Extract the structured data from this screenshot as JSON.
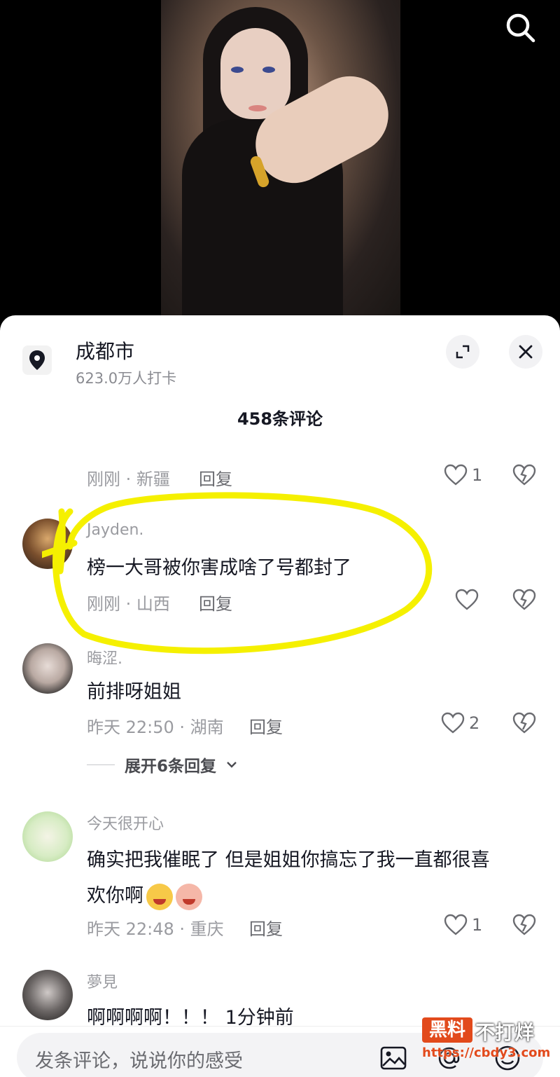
{
  "location": {
    "title": "成都市",
    "subtitle": "623.0万人打卡"
  },
  "comments_header": "458条评论",
  "comments": [
    {
      "username": "Jayden.",
      "text": "榜一大哥被你害成啥了号都封了",
      "time_region": "刚刚 · 山西",
      "reply_label": "回复",
      "likes": ""
    },
    {
      "username": "晦涩.",
      "text": "前排呀姐姐",
      "time_region": "昨天 22:50 · 湖南",
      "reply_label": "回复",
      "likes": "2"
    },
    {
      "username": "今天很开心",
      "text_line1": "确实把我催眠了 但是姐姐你搞忘了我一直都很喜",
      "text_line2": "欢你啊",
      "time_region": "昨天 22:48 · 重庆",
      "reply_label": "回复",
      "likes": "1"
    },
    {
      "username": "夢見",
      "text": "啊啊啊啊！！！ 1分钟前"
    }
  ],
  "partial_comment": {
    "meta": "刚刚 · 新疆",
    "reply_label": "回复",
    "likes": "1"
  },
  "expand_replies": "展开6条回复",
  "input": {
    "placeholder": "发条评论，说说你的感受"
  },
  "watermark": {
    "brand": "黑料",
    "text": "不打烊",
    "url": "https://cbdy3.com"
  },
  "colors": {
    "highlight": "#f5f000",
    "accent": "#e24a1c"
  }
}
